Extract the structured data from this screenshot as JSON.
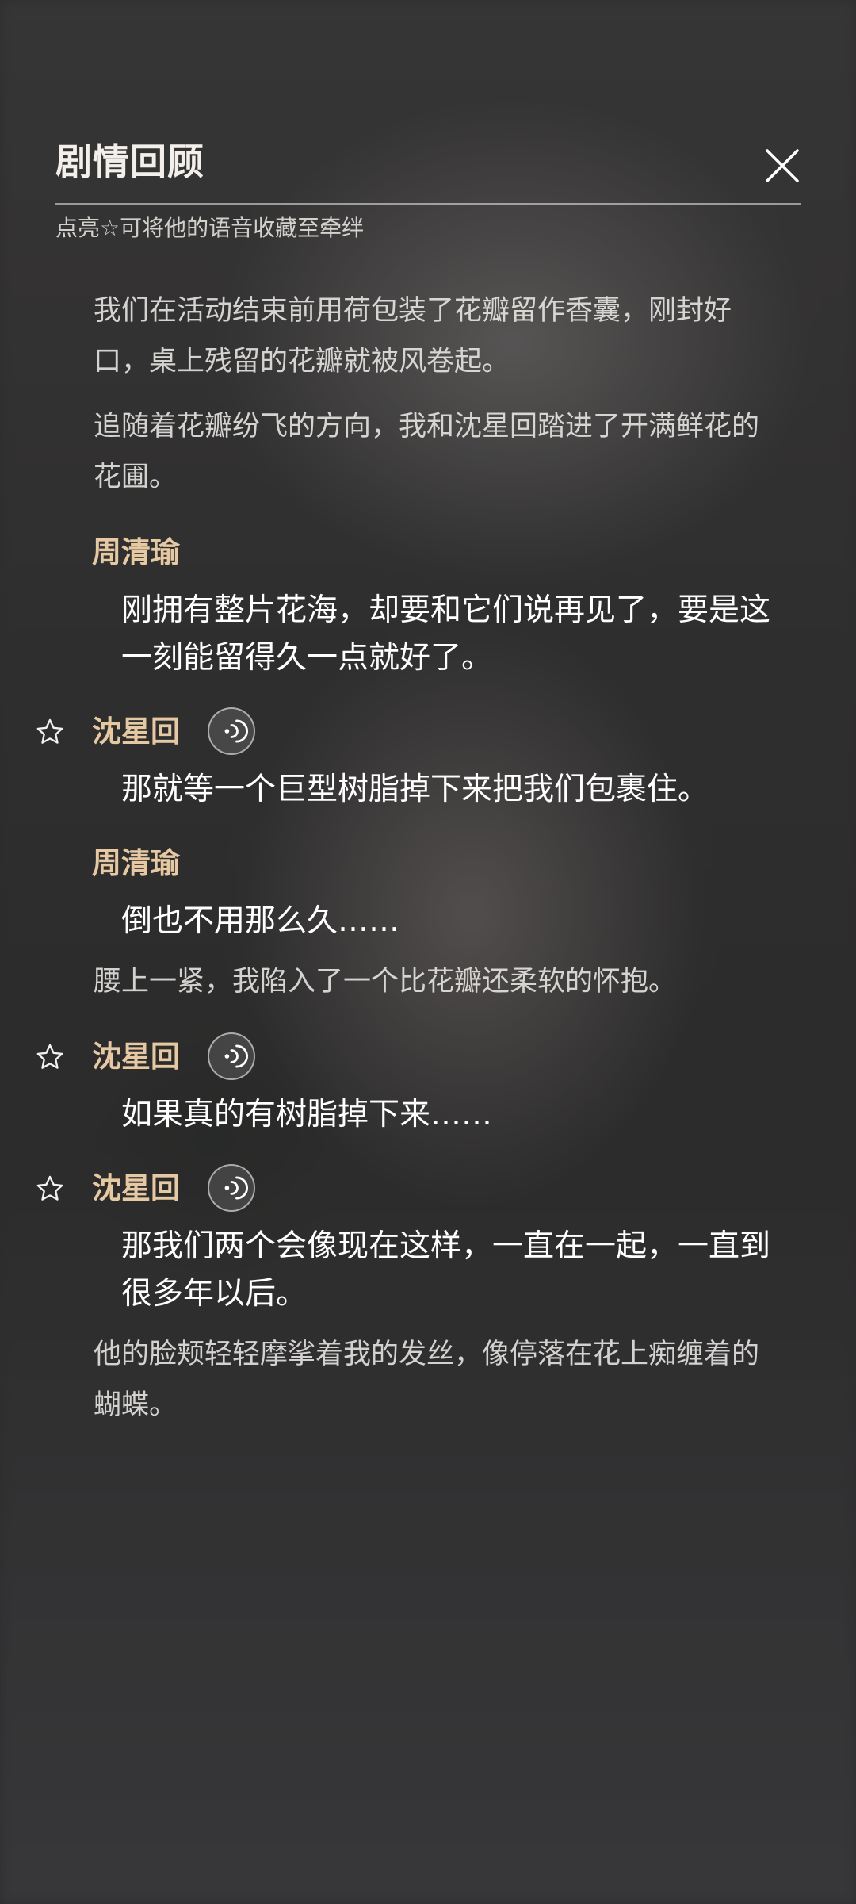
{
  "header": {
    "title": "剧情回顾",
    "hint": "点亮☆可将他的语音收藏至牵绊"
  },
  "entries": [
    {
      "type": "narration",
      "text": "我们在活动结束前用荷包装了花瓣留作香囊，刚封好口，桌上残留的花瓣就被风卷起。"
    },
    {
      "type": "narration",
      "text": "追随着花瓣纷飞的方向，我和沈星回踏进了开满鲜花的花圃。"
    },
    {
      "type": "speaker",
      "name": "周清瑜",
      "star": false,
      "voice": false
    },
    {
      "type": "dialogue",
      "text": "刚拥有整片花海，却要和它们说再见了，要是这一刻能留得久一点就好了。"
    },
    {
      "type": "speaker",
      "name": "沈星回",
      "star": true,
      "voice": true
    },
    {
      "type": "dialogue",
      "text": "那就等一个巨型树脂掉下来把我们包裹住。"
    },
    {
      "type": "speaker",
      "name": "周清瑜",
      "star": false,
      "voice": false
    },
    {
      "type": "dialogue",
      "text": "倒也不用那么久……"
    },
    {
      "type": "narration",
      "text": "腰上一紧，我陷入了一个比花瓣还柔软的怀抱。"
    },
    {
      "type": "speaker",
      "name": "沈星回",
      "star": true,
      "voice": true
    },
    {
      "type": "dialogue",
      "text": "如果真的有树脂掉下来……"
    },
    {
      "type": "speaker",
      "name": "沈星回",
      "star": true,
      "voice": true
    },
    {
      "type": "dialogue",
      "text": "那我们两个会像现在这样，一直在一起，一直到很多年以后。"
    },
    {
      "type": "narration",
      "text": "他的脸颊轻轻摩挲着我的发丝，像停落在花上痴缠着的蝴蝶。"
    }
  ],
  "colors": {
    "speaker": "#e6c9a3",
    "dialogue": "#ffffff",
    "narration": "#ebe9e6"
  },
  "icons": {
    "close": "close-icon",
    "star": "star-outline-icon",
    "voice": "voice-play-icon"
  }
}
